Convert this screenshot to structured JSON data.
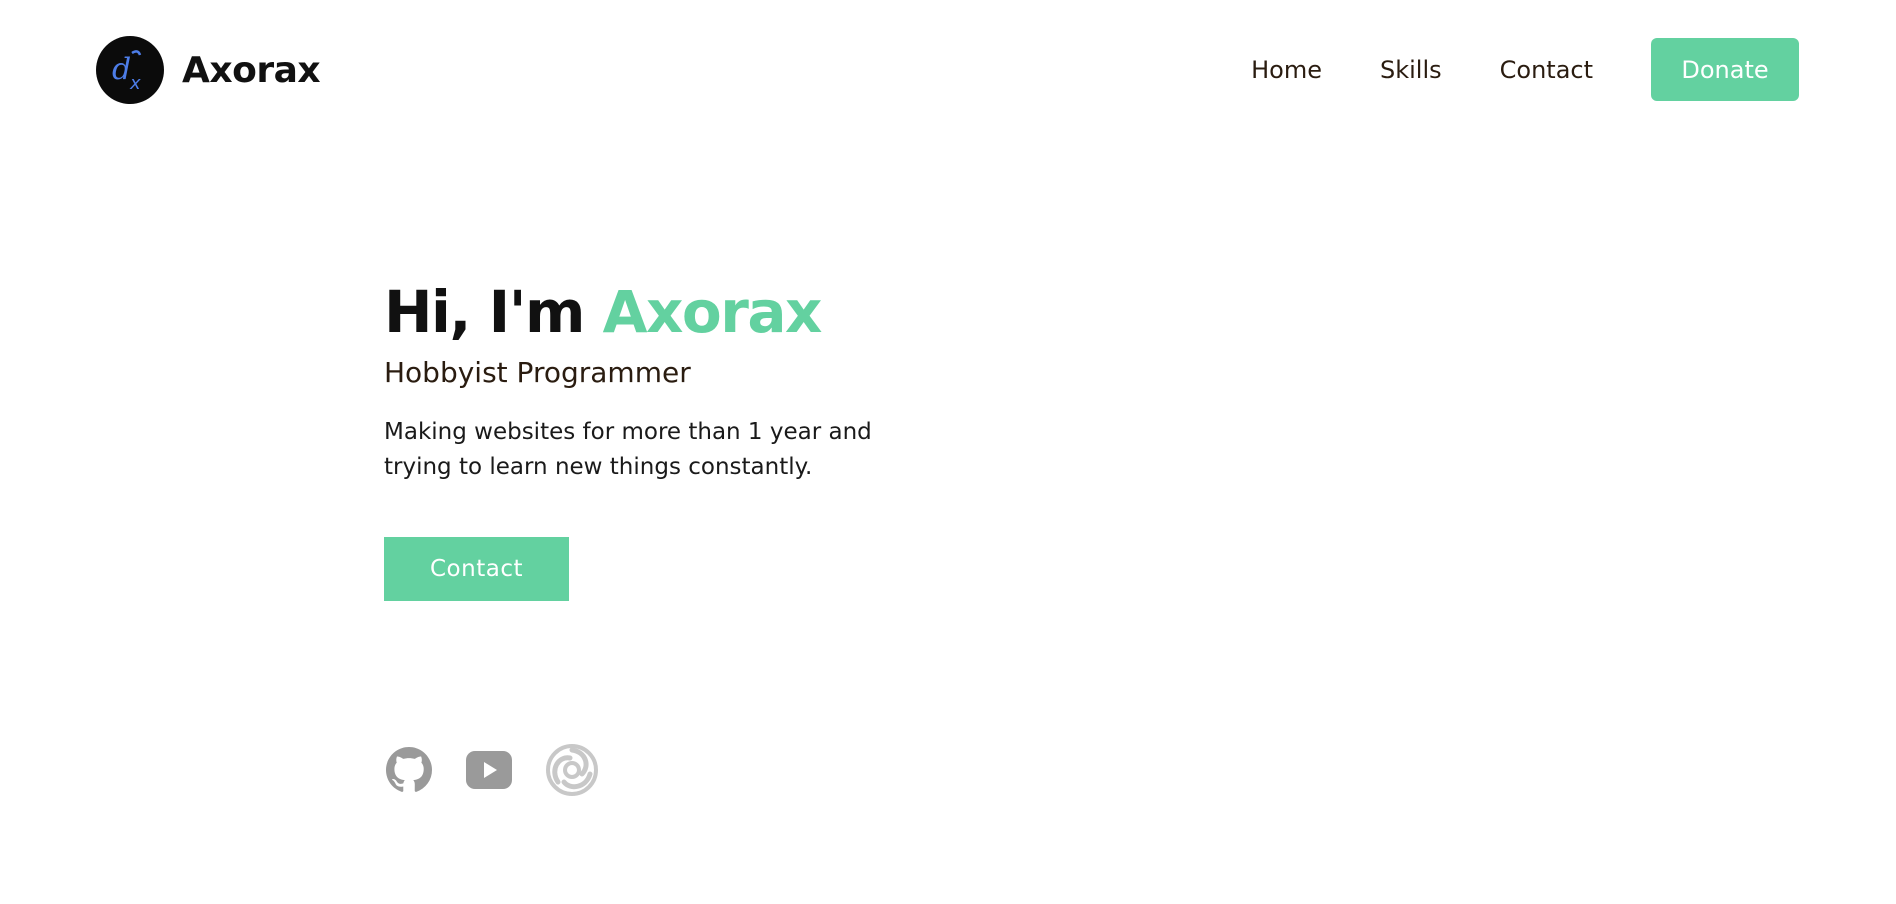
{
  "header": {
    "brand_name": "Axorax",
    "logo_text": "dx",
    "nav": [
      {
        "label": "Home"
      },
      {
        "label": "Skills"
      },
      {
        "label": "Contact"
      }
    ],
    "donate_label": "Donate"
  },
  "hero": {
    "title_prefix": "Hi, I'm ",
    "title_name": "Axorax",
    "subtitle": "Hobbyist Programmer",
    "description": "Making websites for more than 1 year and trying to learn new things constantly.",
    "contact_label": "Contact"
  },
  "socials": [
    {
      "icon": "github-icon"
    },
    {
      "icon": "youtube-icon"
    },
    {
      "icon": "spiral-icon"
    }
  ],
  "colors": {
    "accent": "#63d1a0",
    "logo_bg": "#0b0b0b",
    "logo_glyph": "#4d7de8",
    "icon_gray": "#9a9a9a",
    "icon_light": "#c8c8c8"
  }
}
